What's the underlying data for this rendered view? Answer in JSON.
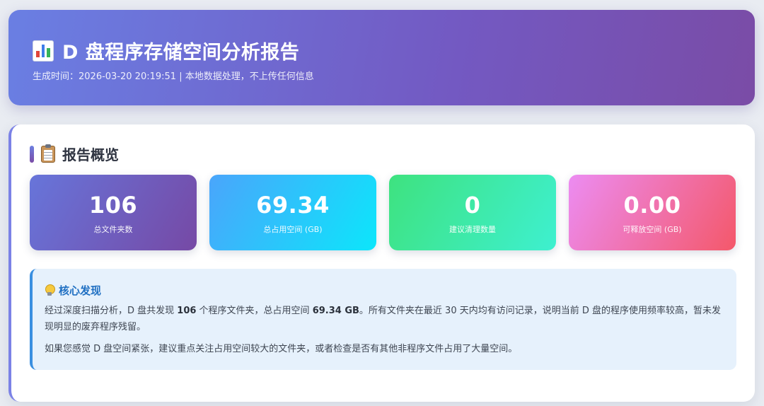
{
  "header": {
    "title": "D 盘程序存储空间分析报告",
    "subtitle": "生成时间：2026-03-20 20:19:51 | 本地数据处理，不上传任何信息",
    "icon": "bar-chart-icon"
  },
  "overview": {
    "title": "报告概览",
    "icon": "clipboard-icon",
    "cards": [
      {
        "value": "106",
        "label": "总文件夹数"
      },
      {
        "value": "69.34",
        "label": "总占用空间 (GB)"
      },
      {
        "value": "0",
        "label": "建议清理数量"
      },
      {
        "value": "0.00",
        "label": "可释放空间 (GB)"
      }
    ]
  },
  "findings": {
    "title": "核心发现",
    "icon": "lightbulb-icon",
    "p1": {
      "pre": "经过深度扫描分析，D 盘共发现 ",
      "count": "106",
      "mid": " 个程序文件夹，总占用空间 ",
      "size": "69.34 GB",
      "post": "。所有文件夹在最近 30 天内均有访问记录，说明当前 D 盘的程序使用频率较高，暂未发现明显的废弃程序残留。"
    },
    "p2": "如果您感觉 D 盘空间紧张，建议重点关注占用空间较大的文件夹，或者检查是否有其他非程序文件占用了大量空间。"
  },
  "colors": {
    "header_gradient": [
      "#6a7fe3",
      "#7a4ca6"
    ],
    "card1": [
      "#6775da",
      "#7649a5"
    ],
    "card2": [
      "#4aa5fb",
      "#0ce6fb"
    ],
    "card3": [
      "#3ee27f",
      "#3ef0d0"
    ],
    "card4": [
      "#ec8cf2",
      "#f4586a"
    ],
    "finding_accent": "#3a8fe0"
  }
}
